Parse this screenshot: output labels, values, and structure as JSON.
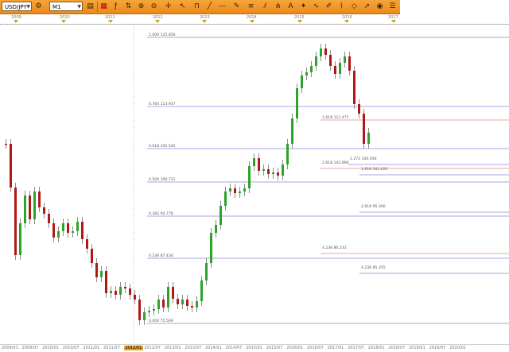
{
  "toolbar": {
    "symbol": "USD/JPY",
    "timeframe": "M1",
    "icons": [
      "order-icon",
      "crosshair-icon",
      "bar-style-icon",
      "indicator-icon",
      "zoom-in-icon",
      "zoom-out-icon",
      "magnet-icon",
      "line-icon",
      "arrow-icon",
      "fib-icon",
      "pitchfork-icon",
      "text-icon",
      "channel-icon",
      "settings-icon",
      "clone-icon",
      "dots-icon",
      "triangle-icon",
      "wave-icon",
      "label-icon",
      "menu-icon"
    ],
    "accent": "#e98a1a"
  },
  "timeline": {
    "years": [
      "2009",
      "2010",
      "2011",
      "2012",
      "2013",
      "2014",
      "2015",
      "2016",
      "2017"
    ]
  },
  "fib_levels": [
    {
      "id": "l1000",
      "label": "1.000 125.856",
      "color": "#8b86d6"
    },
    {
      "id": "l764",
      "label": "0.764 113.937",
      "color": "#8b86d6"
    },
    {
      "id": "l618a",
      "label": "1.618 111.471",
      "color": "#e58a8a"
    },
    {
      "id": "l618b",
      "label": "0.618 105.545",
      "color": "#8b86d6"
    },
    {
      "id": "l1272",
      "label": "1.272 100.056",
      "color": "#8b86d6"
    },
    {
      "id": "l618c",
      "label": "2.618 102.890",
      "color": "#e58a8a"
    },
    {
      "id": "l1618",
      "label": "1.618 101.625",
      "color": "#8b86d6"
    },
    {
      "id": "l500",
      "label": "0.500 100.711",
      "color": "#8b86d6"
    },
    {
      "id": "l382",
      "label": "0.382 94.778",
      "color": "#8b86d6"
    },
    {
      "id": "l2618",
      "label": "2.618 95.300",
      "color": "#8b86d6"
    },
    {
      "id": "l4236a",
      "label": "4.236 80.231",
      "color": "#e58a8a"
    },
    {
      "id": "l236",
      "label": "0.236 87.434",
      "color": "#8b86d6"
    },
    {
      "id": "l4236b",
      "label": "4.236 85.355",
      "color": "#8b86d6"
    },
    {
      "id": "l000",
      "label": "0.000 75.569",
      "color": "#8b86d6"
    }
  ],
  "bottom_dates": [
    "2009/01",
    "2009/07",
    "2010/01",
    "2010/07",
    "2011/01",
    "2011/07",
    "2012/01",
    "2012/07",
    "2013/01",
    "2013/07",
    "2014/01",
    "2014/07",
    "2015/01",
    "2015/07",
    "2016/01",
    "2016/07",
    "2017/01",
    "2017/07",
    "2018/01",
    "2018/07",
    "2019/01",
    "2019/07",
    "2020/01"
  ],
  "colors": {
    "up": "#2aa52a",
    "down": "#b01818"
  }
}
